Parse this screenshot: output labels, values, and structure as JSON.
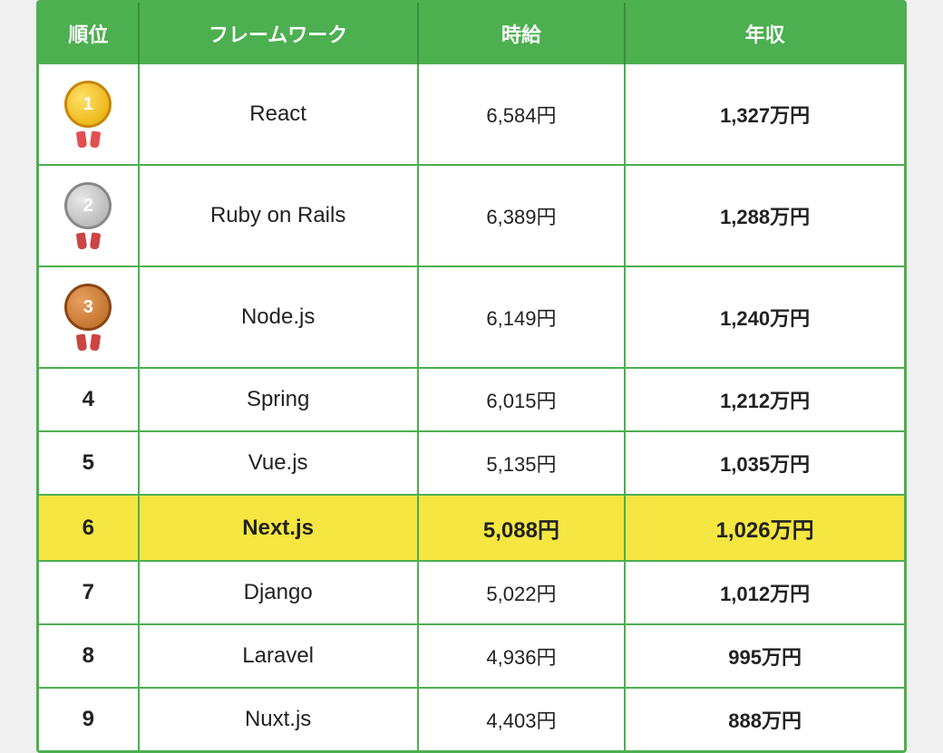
{
  "header": {
    "col_rank": "順位",
    "col_framework": "フレームワーク",
    "col_hourly": "時給",
    "col_annual": "年収"
  },
  "rows": [
    {
      "rank": "1",
      "rank_type": "gold",
      "framework": "React",
      "hourly": "6,584円",
      "annual": "1,327万円",
      "highlight": false
    },
    {
      "rank": "2",
      "rank_type": "silver",
      "framework": "Ruby on Rails",
      "hourly": "6,389円",
      "annual": "1,288万円",
      "highlight": false
    },
    {
      "rank": "3",
      "rank_type": "bronze",
      "framework": "Node.js",
      "hourly": "6,149円",
      "annual": "1,240万円",
      "highlight": false
    },
    {
      "rank": "4",
      "rank_type": "number",
      "framework": "Spring",
      "hourly": "6,015円",
      "annual": "1,212万円",
      "highlight": false
    },
    {
      "rank": "5",
      "rank_type": "number",
      "framework": "Vue.js",
      "hourly": "5,135円",
      "annual": "1,035万円",
      "highlight": false
    },
    {
      "rank": "6",
      "rank_type": "number",
      "framework": "Next.js",
      "hourly": "5,088円",
      "annual": "1,026万円",
      "highlight": true
    },
    {
      "rank": "7",
      "rank_type": "number",
      "framework": "Django",
      "hourly": "5,022円",
      "annual": "1,012万円",
      "highlight": false
    },
    {
      "rank": "8",
      "rank_type": "number",
      "framework": "Laravel",
      "hourly": "4,936円",
      "annual": "995万円",
      "highlight": false
    },
    {
      "rank": "9",
      "rank_type": "number",
      "framework": "Nuxt.js",
      "hourly": "4,403円",
      "annual": "888万円",
      "highlight": false
    }
  ]
}
